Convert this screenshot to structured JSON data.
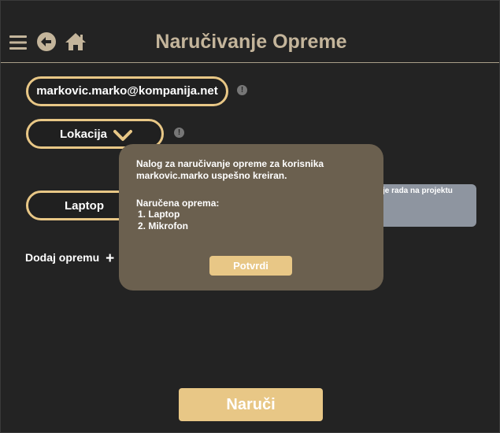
{
  "header": {
    "title": "Naručivanje Opreme",
    "menu_icon": "menu-icon",
    "back_icon": "back-arrow-icon",
    "home_icon": "home-icon"
  },
  "form": {
    "email": "markovic.marko@kompanija.net",
    "location_label": "Lokacija",
    "equipment_label": "Laptop",
    "tooltip_text": "je rada na projektu",
    "add_equipment_label": "Dodaj opremu",
    "add_icon_glyph": "+",
    "info_glyph": "!"
  },
  "modal": {
    "message": "Nalog za naručivanje opreme za korisnika markovic.marko uspešno kreiran.",
    "ordered_title": "Naručena oprema:",
    "items": [
      "1. Laptop",
      "2. Mikrofon"
    ],
    "confirm_label": "Potvrdi"
  },
  "footer": {
    "order_label": "Naruči"
  },
  "colors": {
    "accent": "#e8c786",
    "title": "#c4b59b",
    "background": "#232323",
    "modal": "#6b604f",
    "tooltip": "#8e95a0"
  }
}
